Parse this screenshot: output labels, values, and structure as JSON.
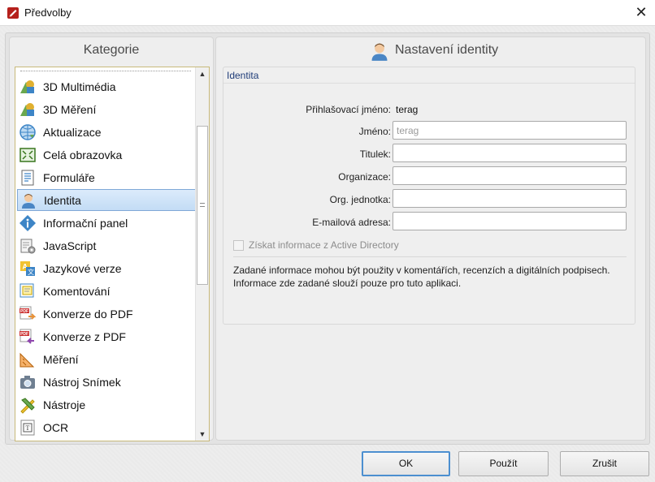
{
  "window": {
    "title": "Předvolby"
  },
  "categories": {
    "header": "Kategorie",
    "items": [
      {
        "label": "3D Multimédia",
        "icon": "3d-multimedia-icon"
      },
      {
        "label": "3D Měření",
        "icon": "3d-measure-icon"
      },
      {
        "label": "Aktualizace",
        "icon": "globe-update-icon"
      },
      {
        "label": "Celá obrazovka",
        "icon": "fullscreen-icon"
      },
      {
        "label": "Formuláře",
        "icon": "form-icon"
      },
      {
        "label": "Identita",
        "icon": "user-icon",
        "selected": true
      },
      {
        "label": "Informační panel",
        "icon": "info-icon"
      },
      {
        "label": "JavaScript",
        "icon": "script-icon"
      },
      {
        "label": "Jazykové verze",
        "icon": "language-icon"
      },
      {
        "label": "Komentování",
        "icon": "comment-icon"
      },
      {
        "label": "Konverze do PDF",
        "icon": "pdf-convert-to-icon"
      },
      {
        "label": "Konverze z PDF",
        "icon": "pdf-convert-from-icon"
      },
      {
        "label": "Měření",
        "icon": "ruler-icon"
      },
      {
        "label": "Nástroj Snímek",
        "icon": "camera-icon"
      },
      {
        "label": "Nástroje",
        "icon": "tools-icon"
      },
      {
        "label": "OCR",
        "icon": "ocr-icon"
      }
    ]
  },
  "identity": {
    "header": "Nastavení identity",
    "group_title": "Identita",
    "login_label": "Přihlašovací jméno:",
    "login_value": "terag",
    "name_label": "Jméno:",
    "name_placeholder": "terag",
    "title_label": "Titulek:",
    "org_label": "Organizace:",
    "org_unit_label": "Org. jednotka:",
    "email_label": "E-mailová adresa:",
    "ad_checkbox_label": "Získat informace z Active Directory",
    "ad_checked": false,
    "info_line1": "Zadané informace mohou být použity v komentářích, recenzích a digitálních podpisech.",
    "info_line2": "Informace zde zadané slouží pouze pro tuto aplikaci."
  },
  "buttons": {
    "ok": "OK",
    "apply": "Použít",
    "cancel": "Zrušit"
  },
  "colors": {
    "selection": "#c3dcf5",
    "selection_border": "#7fa8d7",
    "group_title": "#1f3c78",
    "default_button_border": "#4c8fd0"
  }
}
